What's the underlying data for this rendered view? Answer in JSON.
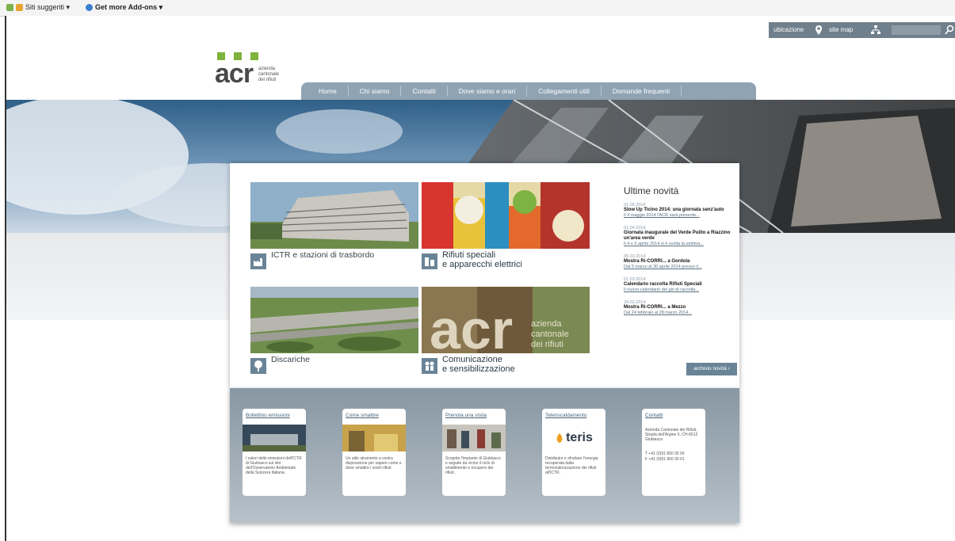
{
  "browser_toolbar": {
    "sites_label": "Siti suggeriti ▾",
    "addons_label": "Get more Add-ons ▾"
  },
  "topbar": {
    "ubicazione": "ubicazione",
    "sitemap": "site map"
  },
  "nav": {
    "tabs": [
      "Home",
      "Chi siamo",
      "Contatti",
      "Dove siamo e orari",
      "Collegamenti utili",
      "Domande frequenti"
    ]
  },
  "logo_text": "acr",
  "tiles": [
    {
      "label_line1": "ICTR e stazioni di trasbordo",
      "label_line2": ""
    },
    {
      "label_line1": "Rifiuti speciali",
      "label_line2": "e apparecchi elettrici"
    },
    {
      "label_line1": "Discariche",
      "label_line2": ""
    },
    {
      "label_line1": "Comunicazione",
      "label_line2": "e sensibilizzazione"
    }
  ],
  "news": {
    "heading": "Ultime novità",
    "items": [
      {
        "date": "01.05.2014",
        "title": "Slow Up Ticino 2014: una giornata senz'auto",
        "summary": "Il 4 maggio 2014 l'ACR sarà presente..."
      },
      {
        "date": "01.04.2014",
        "title": "Giornata inaugurale del Verde Pulito a Riazzino un'area verde",
        "summary": "Il 4 e 5 aprile 2014 si è svolta la settima..."
      },
      {
        "date": "05.03.2014",
        "title": "Mostra Ri-CORRI... a Gordola",
        "summary": "Dal 5 marzo al 30 aprile 2014 presso il..."
      },
      {
        "date": "01.03.2014",
        "title": "Calendario raccolta Rifiuti Speciali",
        "summary": "Il nuovo calendario dei giri di raccolta..."
      },
      {
        "date": "24.02.2014",
        "title": "Mostra Ri-CORRI... a Mezzo",
        "summary": "Dal 24 febbraio al 28 marzo 2014..."
      }
    ],
    "archive_label": "archivio novità ›"
  },
  "bottom_cards": [
    {
      "title": "Bollettino emissioni",
      "text": "I valori delle emissioni dell'ICTR di Giubiasco sul sito dell'Osservatorio Ambientale della Svizzera Italiana."
    },
    {
      "title": "Come smaltire",
      "text": "Un utile strumento a vostra disposizione per sapere come e dove smaltire i vostri rifiuti."
    },
    {
      "title": "Prenota una visita",
      "text": "Scoprite l'impianto di Giubiasco e seguite da vicino il ciclo di smaltimento e recupero dei rifiuti."
    },
    {
      "title": "Teleriscaldamento",
      "text": "Distribuire e sfruttare l'energia recuperata dalla termovalorizzazione dei rifiuti all'ICTR.",
      "logo": "teris"
    },
    {
      "title": "Contatti",
      "text": "Azienda Cantonale dei Rifiuti, Strada dell'Argine 6, CH-6512 Giubiasco",
      "phone": "T +41 (0)91 850 30 00",
      "fax": "F +41 (0)91 850 30 01"
    }
  ]
}
